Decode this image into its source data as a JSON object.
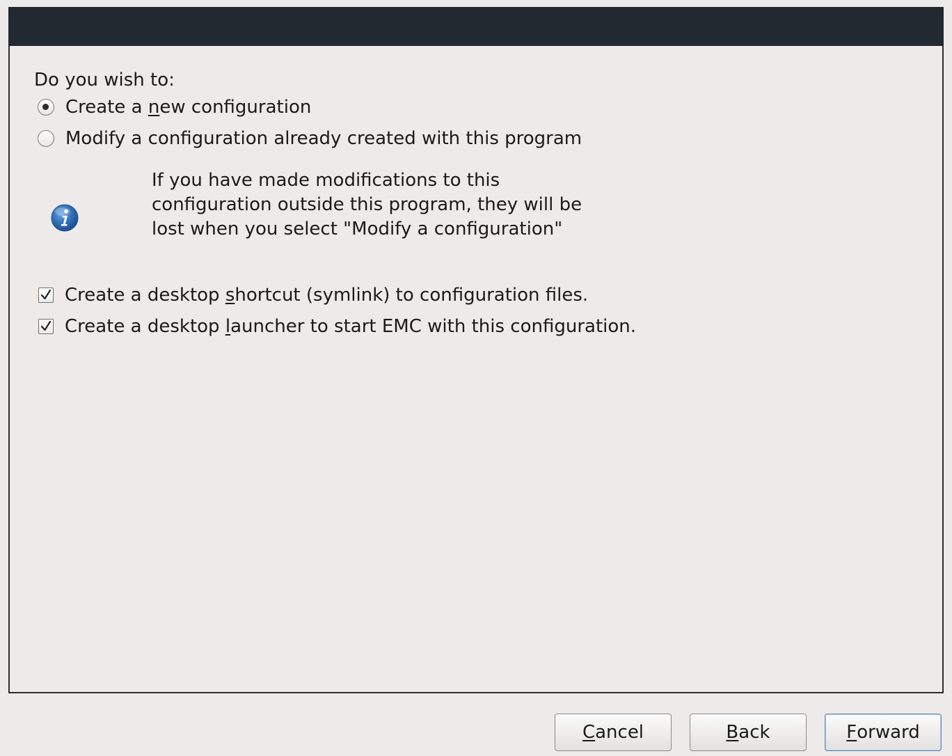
{
  "dialog": {
    "question": "Do you wish to:",
    "options": [
      {
        "pre": "Create a ",
        "mnemonic": "n",
        "post": "ew configuration",
        "selected": true
      },
      {
        "pre": "Modify a configuration already created with this program",
        "mnemonic": "",
        "post": "",
        "selected": false
      }
    ],
    "info_icon": "info-icon",
    "info_text": "If you have made modifications to this configuration outside this program, they will be lost when you select \"Modify a configuration\"",
    "checkboxes": [
      {
        "pre": "Create a desktop ",
        "mnemonic": "s",
        "post": "hortcut (symlink) to configuration files.",
        "checked": true
      },
      {
        "pre": "Create a desktop ",
        "mnemonic": "l",
        "post": "auncher to start EMC with this configuration.",
        "checked": true
      }
    ]
  },
  "buttons": {
    "cancel": {
      "mnemonic": "C",
      "rest": "ancel"
    },
    "back": {
      "mnemonic": "B",
      "rest": "ack"
    },
    "forward": {
      "mnemonic": "F",
      "rest": "orward"
    }
  },
  "colors": {
    "header": "#232930",
    "background": "#edebe9",
    "info_icon": "#2f6db5"
  }
}
